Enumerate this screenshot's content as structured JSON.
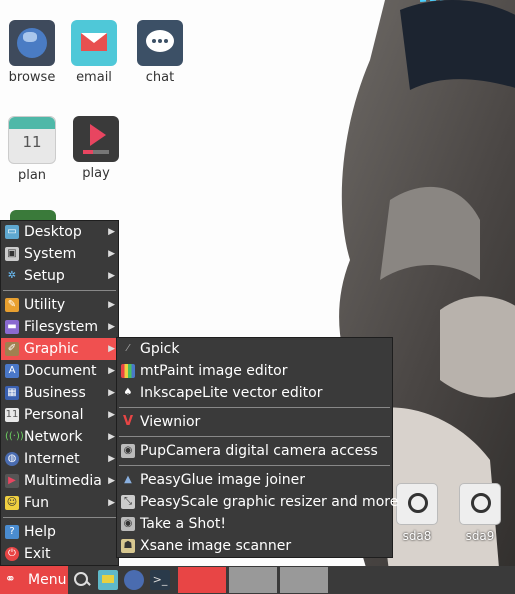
{
  "desktop_icons": [
    {
      "label": "browse",
      "icon": "globe-icon",
      "color": "#3e4a5c"
    },
    {
      "label": "email",
      "icon": "envelope-icon",
      "color": "#4fc8d8"
    },
    {
      "label": "chat",
      "icon": "chat-bubble-icon",
      "color": "#3c5066"
    },
    {
      "label": "plan",
      "icon": "calendar-icon",
      "color": "#e8e8e8",
      "day": "11"
    },
    {
      "label": "play",
      "icon": "play-icon",
      "color": "#3a3a3a"
    }
  ],
  "drives": [
    {
      "label": "sda8",
      "icon": "drive-icon"
    },
    {
      "label": "sda9",
      "icon": "drive-icon"
    }
  ],
  "main_menu": {
    "items": [
      {
        "label": "Desktop",
        "icon": "desktop-icon",
        "submenu": true
      },
      {
        "label": "System",
        "icon": "system-icon",
        "submenu": true
      },
      {
        "label": "Setup",
        "icon": "gear-icon",
        "submenu": true
      },
      {
        "label": "Utility",
        "icon": "wrench-icon",
        "submenu": true
      },
      {
        "label": "Filesystem",
        "icon": "folder-icon",
        "submenu": true
      },
      {
        "label": "Graphic",
        "icon": "paint-icon",
        "submenu": true,
        "active": true
      },
      {
        "label": "Document",
        "icon": "document-icon",
        "submenu": true
      },
      {
        "label": "Business",
        "icon": "calculator-icon",
        "submenu": true
      },
      {
        "label": "Personal",
        "icon": "calendar-icon",
        "submenu": true
      },
      {
        "label": "Network",
        "icon": "network-icon",
        "submenu": true
      },
      {
        "label": "Internet",
        "icon": "globe-icon",
        "submenu": true
      },
      {
        "label": "Multimedia",
        "icon": "multimedia-icon",
        "submenu": true
      },
      {
        "label": "Fun",
        "icon": "smiley-icon",
        "submenu": true
      },
      {
        "label": "Help",
        "icon": "help-icon",
        "submenu": false
      },
      {
        "label": "Exit",
        "icon": "power-icon",
        "submenu": false
      }
    ]
  },
  "graphic_submenu": {
    "items": [
      {
        "label": "Gpick",
        "icon": "color-picker-icon"
      },
      {
        "label": "mtPaint image editor",
        "icon": "mtpaint-icon"
      },
      {
        "label": "InkscapeLite vector editor",
        "icon": "inkscape-icon"
      },
      {
        "label": "Viewnior",
        "icon": "viewnior-icon"
      },
      {
        "label": "PupCamera digital camera access",
        "icon": "camera-icon"
      },
      {
        "label": "PeasyGlue image joiner",
        "icon": "glue-icon"
      },
      {
        "label": "PeasyScale graphic resizer and more",
        "icon": "resize-icon"
      },
      {
        "label": "Take a Shot!",
        "icon": "screenshot-icon"
      },
      {
        "label": "Xsane image scanner",
        "icon": "scanner-icon"
      }
    ]
  },
  "taskbar": {
    "menu_label": "Menu",
    "quick_icons": [
      "search-icon",
      "desktop-icon",
      "globe-icon",
      "terminal-icon"
    ],
    "accent": "#e84545"
  }
}
